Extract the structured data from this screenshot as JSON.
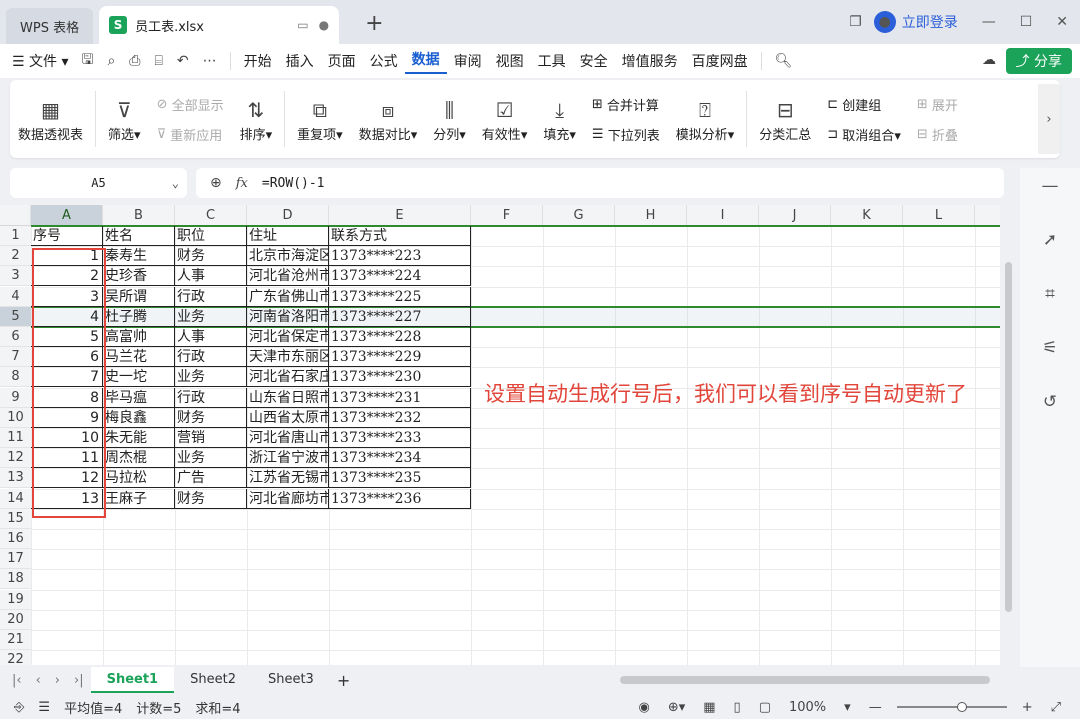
{
  "window": {
    "app_tab": "WPS 表格",
    "file_tab": "员工表.xlsx",
    "login_label": "立即登录",
    "avatar_glyph": "👤"
  },
  "menu": {
    "file": "文件",
    "items": [
      "开始",
      "插入",
      "页面",
      "公式",
      "数据",
      "审阅",
      "视图",
      "工具",
      "安全",
      "增值服务",
      "百度网盘"
    ],
    "active": "数据",
    "share": "分享"
  },
  "ribbon": {
    "pivot": "数据透视表",
    "filter": "筛选",
    "show_all": "全部显示",
    "reapply": "重新应用",
    "sort": "排序",
    "duplicates": "重复项",
    "compare": "数据对比",
    "split": "分列",
    "validity": "有效性",
    "fill": "填充",
    "merge_calc": "合并计算",
    "dropdown_list": "下拉列表",
    "simulate": "模拟分析",
    "subtotal": "分类汇总",
    "create_group": "创建组",
    "ungroup": "取消组合",
    "expand": "展开",
    "collapse": "折叠"
  },
  "formula_bar": {
    "cell_ref": "A5",
    "fx": "fx",
    "formula": "=ROW()-1"
  },
  "columns": [
    "A",
    "B",
    "C",
    "D",
    "E",
    "F",
    "G",
    "H",
    "I",
    "J",
    "K",
    "L"
  ],
  "rows": [
    "1",
    "2",
    "3",
    "4",
    "5",
    "6",
    "7",
    "8",
    "9",
    "10",
    "11",
    "12",
    "13",
    "14",
    "15",
    "16",
    "17",
    "18",
    "19",
    "20",
    "21",
    "22"
  ],
  "table": {
    "header": [
      "序号",
      "姓名",
      "职位",
      "住址",
      "联系方式"
    ],
    "data": [
      [
        "1",
        "秦寿生",
        "财务",
        "北京市海淀区",
        "1373****223"
      ],
      [
        "2",
        "史珍香",
        "人事",
        "河北省沧州市",
        "1373****224"
      ],
      [
        "3",
        "吴所谓",
        "行政",
        "广东省佛山市",
        "1373****225"
      ],
      [
        "4",
        "杜子腾",
        "业务",
        "河南省洛阳市",
        "1373****227"
      ],
      [
        "5",
        "高富帅",
        "人事",
        "河北省保定市",
        "1373****228"
      ],
      [
        "6",
        "马兰花",
        "行政",
        "天津市东丽区",
        "1373****229"
      ],
      [
        "7",
        "史一坨",
        "业务",
        "河北省石家庄",
        "1373****230"
      ],
      [
        "8",
        "毕马瘟",
        "行政",
        "山东省日照市",
        "1373****231"
      ],
      [
        "9",
        "梅良鑫",
        "财务",
        "山西省太原市",
        "1373****232"
      ],
      [
        "10",
        "朱无能",
        "营销",
        "河北省唐山市",
        "1373****233"
      ],
      [
        "11",
        "周杰棍",
        "业务",
        "浙江省宁波市",
        "1373****234"
      ],
      [
        "12",
        "马拉松",
        "广告",
        "江苏省无锡市",
        "1373****235"
      ],
      [
        "13",
        "王麻子",
        "财务",
        "河北省廊坊市",
        "1373****236"
      ]
    ]
  },
  "annotation": "设置自动生成行号后，我们可以看到序号自动更新了",
  "sheets": [
    "Sheet1",
    "Sheet2",
    "Sheet3"
  ],
  "active_sheet": "Sheet1",
  "status": {
    "average": "平均值=4",
    "count": "计数=5",
    "sum": "求和=4",
    "zoom": "100%"
  },
  "colors": {
    "accent": "#1ba35a",
    "menu_active": "#1a5fd0",
    "annotation": "#e2453a"
  }
}
